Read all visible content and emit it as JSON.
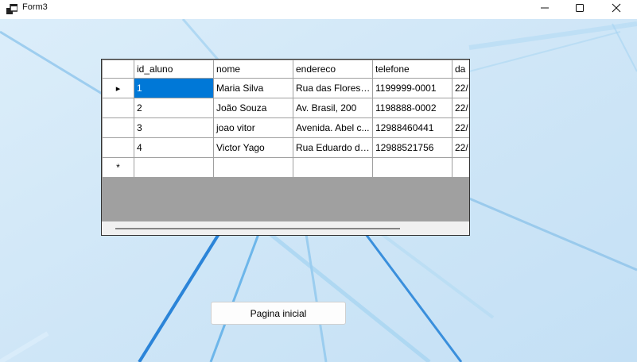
{
  "window": {
    "title": "Form3",
    "icon": "form-app-icon",
    "controls": [
      "minimize-icon",
      "maximize-icon",
      "close-icon"
    ]
  },
  "grid": {
    "columns": [
      "id_aluno",
      "nome",
      "endereco",
      "telefone",
      "da"
    ],
    "rows": [
      {
        "id_aluno": "1",
        "nome": "Maria Silva",
        "endereco": "Rua das Flores, ...",
        "telefone": "1199999-0001",
        "da": "22/"
      },
      {
        "id_aluno": "2",
        "nome": "João Souza",
        "endereco": "Av. Brasil, 200",
        "telefone": "1198888-0002",
        "da": "22/"
      },
      {
        "id_aluno": "3",
        "nome": "joao vitor",
        "endereco": "Avenida. Abel c...",
        "telefone": "12988460441",
        "da": "22/"
      },
      {
        "id_aluno": "4",
        "nome": "Victor Yago",
        "endereco": "Rua Eduardo da...",
        "telefone": "12988521756",
        "da": "22/"
      }
    ],
    "current_row_marker": "▸",
    "new_row_marker": "*",
    "selected_cell": {
      "row": 0,
      "column": "id_aluno"
    },
    "selection_color": "#0078d7"
  },
  "button": {
    "label": "Pagina inicial"
  },
  "colors": {
    "background": "#d2e8f7",
    "grid_empty_area": "#a0a0a0"
  }
}
